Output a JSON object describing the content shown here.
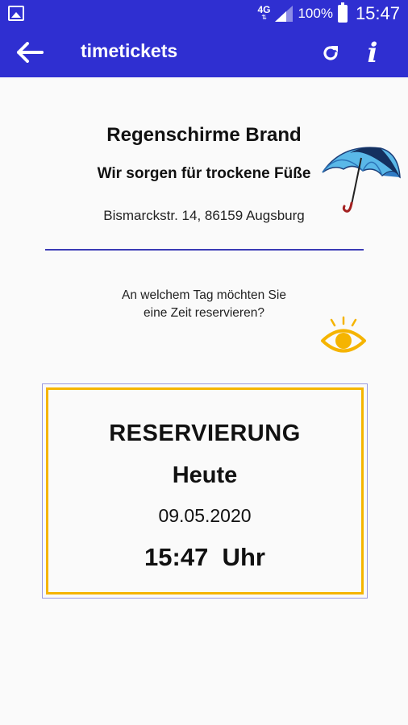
{
  "status_bar": {
    "network_label": "4G",
    "battery_percent": "100%",
    "time": "15:47",
    "icons": [
      "gallery-icon",
      "signal-icon",
      "battery-icon"
    ]
  },
  "app_bar": {
    "title": "timetickets",
    "background_color": "#2f2fd1",
    "icons": [
      "back-arrow-icon",
      "refresh-icon",
      "info-icon"
    ],
    "info_glyph": "i"
  },
  "business": {
    "name": "Regenschirme Brand",
    "slogan": "Wir sorgen für trockene Füße",
    "address": "Bismarckstr. 14, 86159 Augsburg",
    "logo_icon": "umbrella-icon"
  },
  "question": {
    "line1": "An welchem Tag möchten Sie",
    "line2": "eine Zeit reservieren?",
    "icon": "eye-icon"
  },
  "reservation": {
    "title": "RESERVIERUNG",
    "day": "Heute",
    "date": "09.05.2020",
    "time": "15:47  Uhr",
    "border_color": "#f5b400"
  }
}
